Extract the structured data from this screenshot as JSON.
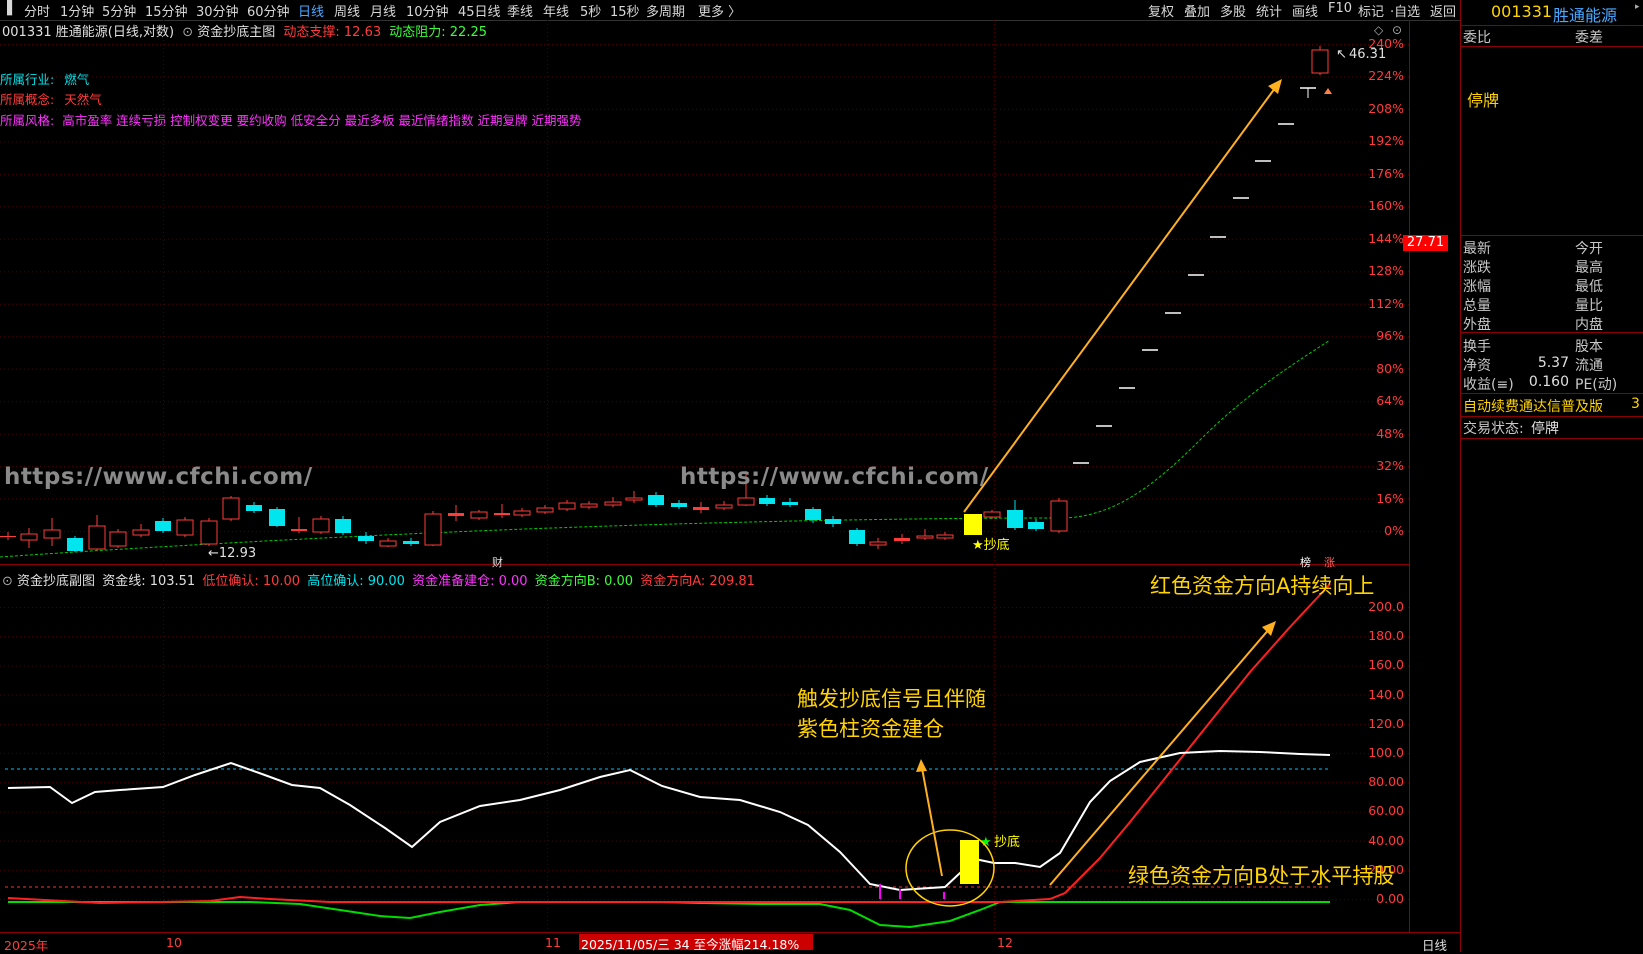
{
  "top_toolbar": {
    "menu_icon": "menu-icon",
    "periods": [
      "分时",
      "1分钟",
      "5分钟",
      "15分钟",
      "30分钟",
      "60分钟",
      "日线",
      "周线",
      "月线",
      "10分钟",
      "45日线",
      "季线",
      "年线",
      "5秒",
      "15秒",
      "多周期",
      "更多 〉"
    ],
    "active_period": "日线",
    "right_tools": [
      "复权",
      "叠加",
      "多股",
      "统计",
      "画线",
      "F10",
      "标记",
      "·自选",
      "返回"
    ]
  },
  "stock_header": {
    "code": "001331",
    "name": "胜通能源"
  },
  "main_chart": {
    "title_prefix": "001331 胜通能源(日线,对数)",
    "indicator_name": "资金抄底主图",
    "support_label": "动态支撑: 12.63",
    "resistance_label": "动态阻力: 22.25",
    "industry_label": "所属行业:",
    "industry_value": "燃气",
    "concept_label": "所属概念:",
    "concept_value": "天然气",
    "style_label": "所属风格:",
    "style_value": "高市盈率 连续亏损 控制权变更 要约收购 低安全分 最近多板 最近情绪指数 近期复牌 近期强势",
    "watermark": "https://www.cfchi.com/",
    "low_marker": "←12.93",
    "high_marker": "46.31",
    "current_price_tag": "27.71",
    "signal_text": "★抄底",
    "fin_marker": "财",
    "rank_marker": "榜",
    "up_marker": "涨",
    "y_axis": [
      "240%",
      "224%",
      "208%",
      "192%",
      "176%",
      "160%",
      "144%",
      "128%",
      "112%",
      "96%",
      "80%",
      "64%",
      "48%",
      "32%",
      "16%",
      "0%"
    ]
  },
  "sub_chart": {
    "title": "资金抄底副图",
    "line_label": "资金线: 103.51",
    "low_confirm": "低位确认: 10.00",
    "high_confirm": "高位确认: 90.00",
    "prep_label": "资金准备建仓: 0.00",
    "dir_b_label": "资金方向B: 0.00",
    "dir_a_label": "资金方向A: 209.81",
    "signal_text": "★抄底",
    "y_axis": [
      "200.0",
      "180.0",
      "160.0",
      "140.0",
      "120.0",
      "100.0",
      "80.00",
      "60.00",
      "40.00",
      "20.00",
      "0.00"
    ],
    "annotation_red": "红色资金方向A持续向上",
    "annotation_signal_1": "触发抄底信号且伴随",
    "annotation_signal_2": "紫色柱资金建仓",
    "annotation_green": "绿色资金方向B处于水平持股"
  },
  "x_axis": {
    "labels": [
      "2025年",
      "10",
      "11",
      "12"
    ],
    "cursor_info": "2025/11/05/三 34 至今涨幅214.18%",
    "period_tag": "日线"
  },
  "right_panel": {
    "header_code": "001331",
    "header_name": "胜通能源",
    "ratio_label": "委比",
    "diff_label": "委差",
    "suspended": "停牌",
    "quote_left": [
      "最新",
      "涨跌",
      "涨幅",
      "总量",
      "外盘"
    ],
    "quote_right": [
      "今开",
      "最高",
      "最低",
      "量比",
      "内盘"
    ],
    "turnover_label": "换手",
    "equity_label": "股本",
    "netasset_label": "净资",
    "netasset_value": "5.37",
    "float_label": "流通",
    "eps_label": "收益(≡)",
    "eps_value": "0.160",
    "pe_label": "PE(动)",
    "promo_text": "自动续费通达信普及版",
    "promo_num": "3",
    "trade_status_label": "交易状态:",
    "trade_status_value": "停牌"
  },
  "colors": {
    "up": "#ff3c3c",
    "down": "#00e5ee",
    "signal": "#ffff00",
    "annotation": "#ffd400",
    "purple": "#ff00ff",
    "green_line": "#00cc00"
  }
}
